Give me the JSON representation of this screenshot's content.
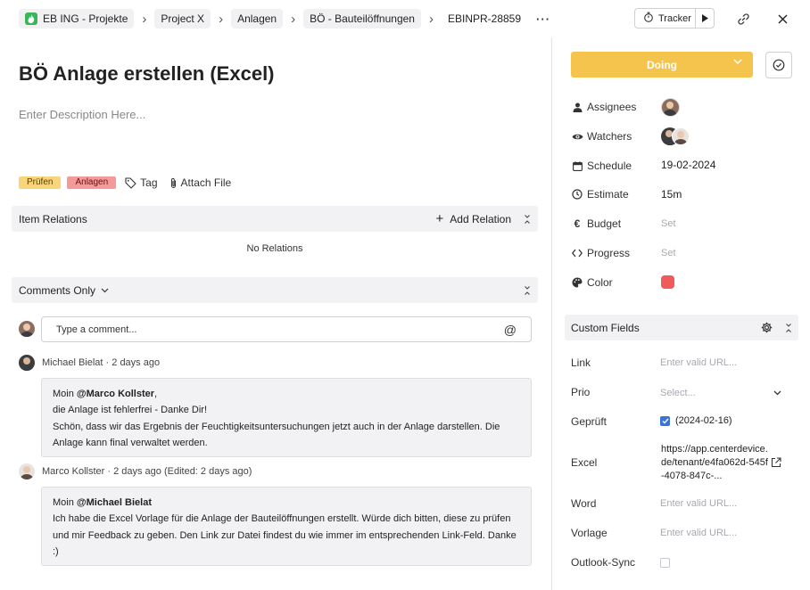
{
  "breadcrumb": {
    "items": [
      "EB ING - Projekte",
      "Project X",
      "Anlagen",
      "BÖ - Bauteilöffnungen",
      "EBINPR-28859"
    ],
    "more": "···"
  },
  "tracker": {
    "label": "Tracker"
  },
  "item": {
    "title": "BÖ Anlage erstellen (Excel)",
    "description_placeholder": "Enter Description Here...",
    "tags": [
      "Prüfen",
      "Anlagen"
    ],
    "tag_button": "Tag",
    "attach_button": "Attach File"
  },
  "relations": {
    "title": "Item Relations",
    "add_button": "Add Relation",
    "empty_text": "No Relations"
  },
  "comments": {
    "filter": "Comments Only",
    "input_placeholder": "Type a comment...",
    "list": [
      {
        "author": "Michael Bielat",
        "meta": "· 2 days ago",
        "greeting": "Moin ",
        "mention": "@Marco Kollster",
        "after_mention": ",",
        "lines": [
          "die Anlage ist fehlerfrei - Danke Dir!",
          "Schön, dass wir das Ergebnis der Feuchtigkeitsuntersuchungen jetzt auch in der Anlage darstellen. Die Anlage kann final verwaltet werden."
        ]
      },
      {
        "author": "Marco Kollster",
        "meta": "· 2 days ago (Edited: 2 days ago)",
        "greeting": "Moin ",
        "mention": "@Michael Bielat",
        "after_mention": "",
        "lines": [
          "Ich habe die Excel Vorlage für die Anlage der Bauteilöffnungen erstellt. Würde dich bitten, diese zu prüfen und mir Feedback zu geben. Den Link zur Datei findest du wie immer im entsprechenden Link-Feld. Danke :)"
        ]
      }
    ]
  },
  "status": {
    "label": "Doing",
    "color": "#f5c44d"
  },
  "properties": {
    "assignees_label": "Assignees",
    "watchers_label": "Watchers",
    "schedule_label": "Schedule",
    "schedule_value": "19-02-2024",
    "estimate_label": "Estimate",
    "estimate_value": "15m",
    "budget_label": "Budget",
    "budget_value": "Set",
    "progress_label": "Progress",
    "progress_value": "Set",
    "color_label": "Color",
    "color_value": "#ef5b5b"
  },
  "custom_fields": {
    "title": "Custom Fields",
    "link_label": "Link",
    "link_placeholder": "Enter valid URL...",
    "prio_label": "Prio",
    "prio_placeholder": "Select...",
    "geprueft_label": "Geprüft",
    "geprueft_value": "(2024-02-16)",
    "excel_label": "Excel",
    "excel_value": "https://app.centerdevice.de/tenant/e4fa062d-545f-4078-847c-...",
    "word_label": "Word",
    "word_placeholder": "Enter valid URL...",
    "vorlage_label": "Vorlage",
    "vorlage_placeholder": "Enter valid URL...",
    "outlook_label": "Outlook-Sync"
  }
}
